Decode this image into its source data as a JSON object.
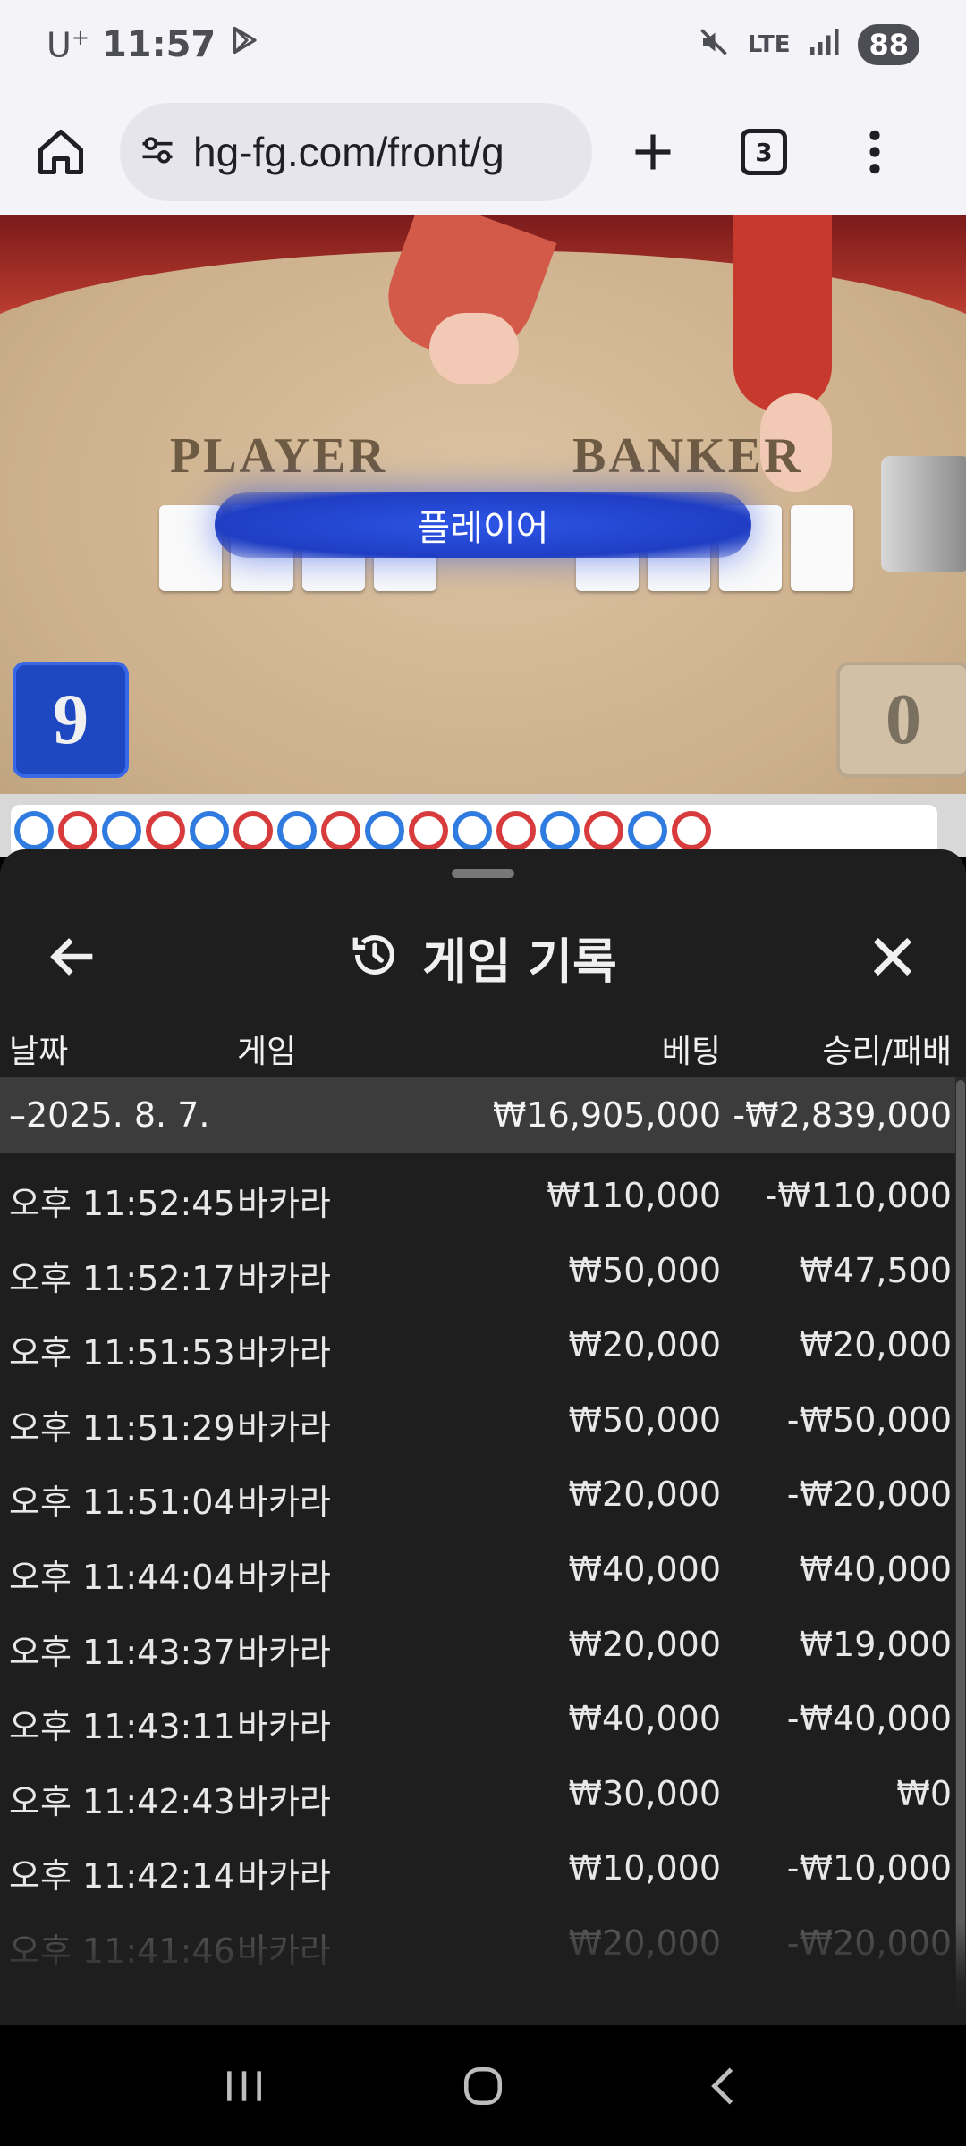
{
  "status_bar": {
    "carrier": "U",
    "carrier_sup": "+",
    "time": "11:57",
    "network": "LTE",
    "battery": "88"
  },
  "browser": {
    "url": "hg-fg.com/front/g",
    "tab_count": "3"
  },
  "game_view": {
    "player_label": "PLAYER",
    "banker_label": "BANKER",
    "result_banner": "플레이어",
    "player_score": "9",
    "banker_score": "0"
  },
  "road": {
    "beads": [
      "player",
      "banker",
      "player",
      "banker",
      "player",
      "banker",
      "player",
      "banker",
      "player",
      "banker",
      "player",
      "banker",
      "player",
      "banker",
      "player",
      "banker"
    ]
  },
  "history": {
    "title": "게임 기록",
    "columns": {
      "date": "날짜",
      "game": "게임",
      "bet": "베팅",
      "win_loss": "승리/패배"
    },
    "date_group": {
      "date": "–2025. 8. 7.",
      "bet": "₩16,905,000",
      "win_loss": "-₩2,839,000"
    },
    "rows": [
      {
        "time": "오후 11:52:45",
        "game": "바카라",
        "bet": "₩110,000",
        "win_loss": "-₩110,000"
      },
      {
        "time": "오후 11:52:17",
        "game": "바카라",
        "bet": "₩50,000",
        "win_loss": "₩47,500"
      },
      {
        "time": "오후 11:51:53",
        "game": "바카라",
        "bet": "₩20,000",
        "win_loss": "₩20,000"
      },
      {
        "time": "오후 11:51:29",
        "game": "바카라",
        "bet": "₩50,000",
        "win_loss": "-₩50,000"
      },
      {
        "time": "오후 11:51:04",
        "game": "바카라",
        "bet": "₩20,000",
        "win_loss": "-₩20,000"
      },
      {
        "time": "오후 11:44:04",
        "game": "바카라",
        "bet": "₩40,000",
        "win_loss": "₩40,000"
      },
      {
        "time": "오후 11:43:37",
        "game": "바카라",
        "bet": "₩20,000",
        "win_loss": "₩19,000"
      },
      {
        "time": "오후 11:43:11",
        "game": "바카라",
        "bet": "₩40,000",
        "win_loss": "-₩40,000"
      },
      {
        "time": "오후 11:42:43",
        "game": "바카라",
        "bet": "₩30,000",
        "win_loss": "₩0"
      },
      {
        "time": "오후 11:42:14",
        "game": "바카라",
        "bet": "₩10,000",
        "win_loss": "-₩10,000"
      },
      {
        "time": "오후 11:41:46",
        "game": "바카라",
        "bet": "₩20,000",
        "win_loss": "-₩20,000"
      }
    ]
  },
  "icons": {
    "home": "home-icon",
    "site_settings": "tune-icon",
    "new_tab": "plus-icon",
    "menu": "more-vert-icon",
    "back": "arrow-left-icon",
    "history": "history-icon",
    "close": "close-icon"
  },
  "colors": {
    "player_blue": "#2f7be0",
    "banker_red": "#d83b3b",
    "sheet_bg": "#1e1e1e",
    "date_row_bg": "#3c3c3c"
  }
}
